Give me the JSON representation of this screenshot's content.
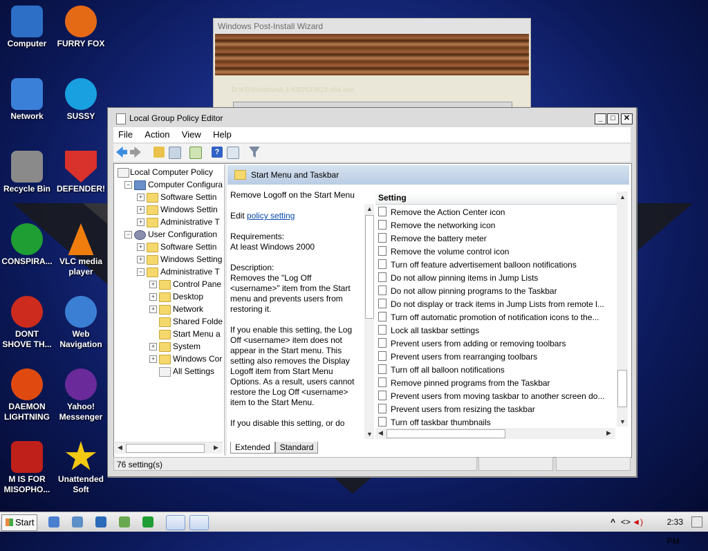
{
  "desktop_icons": [
    {
      "label": "Computer",
      "icon": "computer-icon",
      "color": "#2d6fc7"
    },
    {
      "label": "FURRY FOX",
      "icon": "firefox-icon",
      "color": "#e56a16"
    },
    {
      "label": "Network",
      "icon": "network-icon",
      "color": "#3b80d8"
    },
    {
      "label": "SUSSY",
      "icon": "skype-icon",
      "color": "#19a0e0"
    },
    {
      "label": "Recycle Bin",
      "icon": "recycle-bin-icon",
      "color": "#8a8a8a"
    },
    {
      "label": "DEFENDER!",
      "icon": "shield-icon",
      "color": "#d9312b"
    },
    {
      "label": "CONSPIRA...",
      "icon": "utorrent-icon",
      "color": "#1e9e33"
    },
    {
      "label": "VLC media player",
      "icon": "vlc-icon",
      "color": "#ef7d0e"
    },
    {
      "label": "DONT SHOVE TH...",
      "icon": "ccleaner-icon",
      "color": "#cc2b1d"
    },
    {
      "label": "Web Navigation",
      "icon": "globe-icon",
      "color": "#3a7fd3"
    },
    {
      "label": "DAEMON LIGHTNING",
      "icon": "daemon-icon",
      "color": "#e04a10"
    },
    {
      "label": "Yahoo! Messenger",
      "icon": "yahoo-icon",
      "color": "#6a2a9a"
    },
    {
      "label": "M IS FOR MISOPHO...",
      "icon": "malwarebytes-icon",
      "color": "#c0201a"
    },
    {
      "label": "Unattended Soft",
      "icon": "star-icon",
      "color": "#f2c812"
    }
  ],
  "wizard": {
    "title": "Windows Post-Install Wizard",
    "path": "D:\\KB\\Windows6.1-KB2533623-x64.exe"
  },
  "gpe": {
    "title": "Local Group Policy Editor",
    "controls": {
      "minimize": "_",
      "maximize": "□",
      "close": "✕"
    },
    "menu": [
      "File",
      "Action",
      "View",
      "Help"
    ],
    "tree": [
      {
        "label": "Local Computer Policy",
        "level": 0,
        "expander": "",
        "icon": "policy"
      },
      {
        "label": "Computer Configura",
        "level": 1,
        "expander": "−",
        "icon": "computer"
      },
      {
        "label": "Software Settin",
        "level": 2,
        "expander": "+",
        "icon": "folder"
      },
      {
        "label": "Windows Settin",
        "level": 2,
        "expander": "+",
        "icon": "folder"
      },
      {
        "label": "Administrative T",
        "level": 2,
        "expander": "+",
        "icon": "folder"
      },
      {
        "label": "User Configuration",
        "level": 1,
        "expander": "−",
        "icon": "user"
      },
      {
        "label": "Software Settin",
        "level": 2,
        "expander": "+",
        "icon": "folder"
      },
      {
        "label": "Windows Setting",
        "level": 2,
        "expander": "+",
        "icon": "folder"
      },
      {
        "label": "Administrative T",
        "level": 2,
        "expander": "−",
        "icon": "folder"
      },
      {
        "label": "Control Pane",
        "level": 3,
        "expander": "+",
        "icon": "folder"
      },
      {
        "label": "Desktop",
        "level": 3,
        "expander": "+",
        "icon": "folder"
      },
      {
        "label": "Network",
        "level": 3,
        "expander": "+",
        "icon": "folder"
      },
      {
        "label": "Shared Folde",
        "level": 3,
        "expander": "",
        "icon": "folder"
      },
      {
        "label": "Start Menu a",
        "level": 3,
        "expander": "",
        "icon": "folder"
      },
      {
        "label": "System",
        "level": 3,
        "expander": "+",
        "icon": "folder"
      },
      {
        "label": "Windows Cor",
        "level": 3,
        "expander": "+",
        "icon": "folder"
      },
      {
        "label": "All Settings",
        "level": 3,
        "expander": "",
        "icon": "settings"
      }
    ],
    "right_header": "Start Menu and Taskbar",
    "extended": {
      "title": "Remove Logoff on the Start Menu",
      "edit_prefix": "Edit",
      "edit_link": "policy setting",
      "req_label": "Requirements:",
      "req_value": "At least Windows 2000",
      "desc_label": "Description:",
      "desc1": "Removes the \"Log Off <username>\" item from the Start menu and prevents users from restoring it.",
      "desc2": "If you enable this setting, the Log Off <username> item does not appear in the Start menu. This setting also removes the Display Logoff item from Start Menu Options. As a result, users cannot restore the Log Off <username> item to the Start Menu.",
      "desc3": "If you disable this setting, or do"
    },
    "column_header": "Setting",
    "settings": [
      "Remove the Action Center icon",
      "Remove the networking icon",
      "Remove the battery meter",
      "Remove the volume control icon",
      "Turn off feature advertisement balloon notifications",
      "Do not allow pinning items in Jump Lists",
      "Do not allow pinning programs to the Taskbar",
      "Do not display or track items in Jump Lists from remote l...",
      "Turn off automatic promotion of notification icons to the...",
      "Lock all taskbar settings",
      "Prevent users from adding or removing toolbars",
      "Prevent users from rearranging toolbars",
      "Turn off all balloon notifications",
      "Remove pinned programs from the Taskbar",
      "Prevent users from moving taskbar to another screen do...",
      "Prevent users from resizing the taskbar",
      "Turn off taskbar thumbnails"
    ],
    "tabs": [
      "Extended",
      "Standard"
    ],
    "status": "76 setting(s)"
  },
  "taskbar": {
    "start": "Start",
    "clock": "2:33 PM",
    "tray_icons": [
      "chevron-up-icon",
      "network-icon",
      "volume-icon",
      "flag-icon"
    ],
    "quicklaunch": [
      "ie-icon",
      "explorer-icon",
      "search-icon",
      "notepad-icon",
      "utorrent-icon",
      "gpe-task-icon",
      "app-task-icon"
    ]
  }
}
